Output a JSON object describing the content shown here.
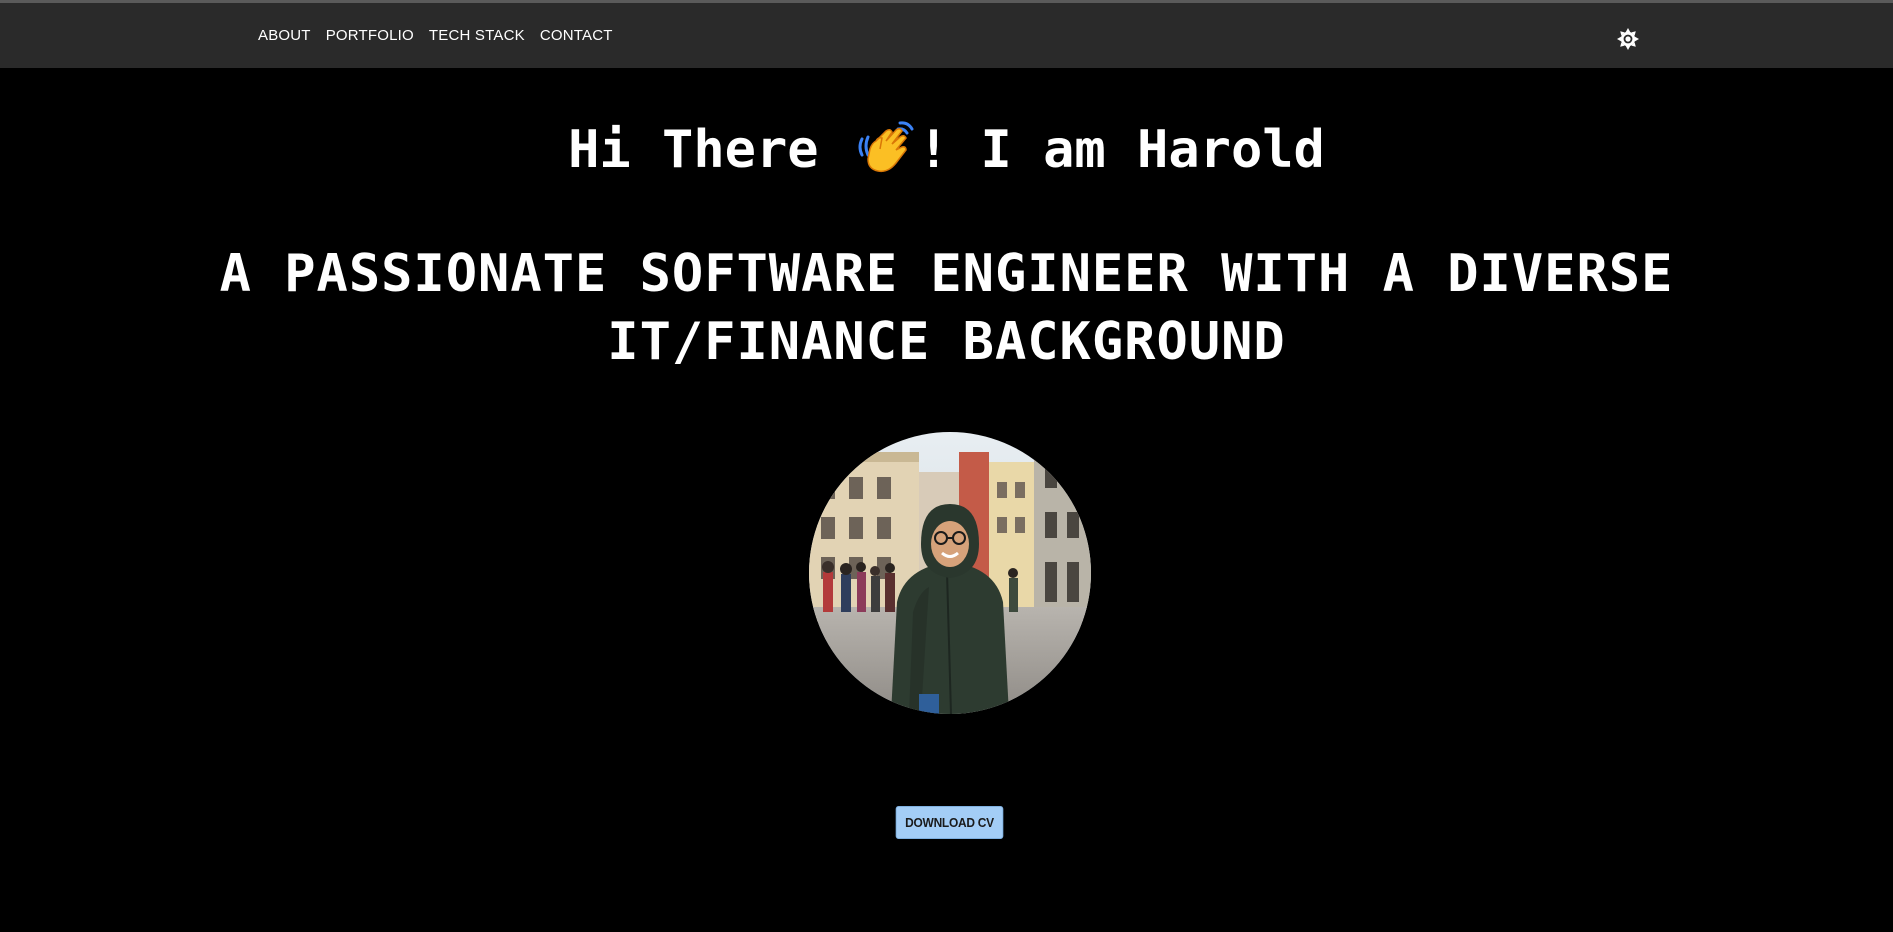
{
  "nav": {
    "items": [
      {
        "label": "ABOUT"
      },
      {
        "label": "PORTFOLIO"
      },
      {
        "label": "TECH STACK"
      },
      {
        "label": "CONTACT"
      }
    ],
    "theme_toggle_icon": "sun-icon"
  },
  "hero": {
    "greeting_before": "Hi There ",
    "greeting_icon": "waving-hand-icon",
    "greeting_after": "! I am Harold",
    "subtitle": "A PASSIONATE SOFTWARE ENGINEER WITH A DIVERSE IT/FINANCE BACKGROUND",
    "avatar_icon": "profile-photo",
    "cv_button_label": "DOWNLOAD CV"
  },
  "colors": {
    "background": "#000000",
    "topbar": "#2a2a2a",
    "text": "#ffffff",
    "button_bg": "#a3cdf6",
    "button_text": "#1a1a1a"
  }
}
